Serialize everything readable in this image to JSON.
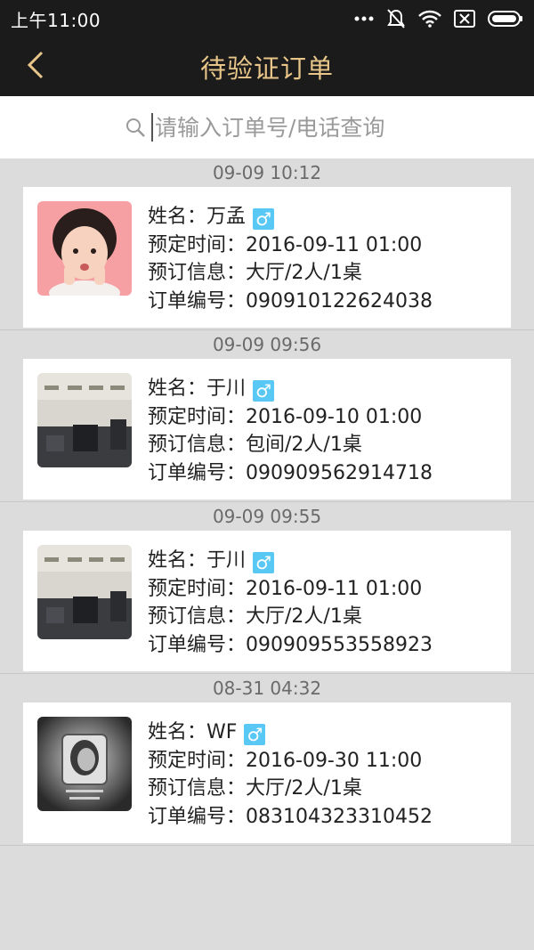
{
  "status_bar": {
    "time": "上午11:00",
    "icons": [
      "more-dots-icon",
      "mute-bell-icon",
      "wifi-icon",
      "sim-x-icon",
      "battery-icon"
    ]
  },
  "header": {
    "title": "待验证订单",
    "back_icon": "chevron-left-icon"
  },
  "search": {
    "placeholder": "请输入订单号/电话查询",
    "icon": "search-icon"
  },
  "colors": {
    "bar_bg": "#1b1b1b",
    "title": "#e8c68a",
    "page_bg": "#dcdcdc",
    "gender_badge": "#5ac8f5"
  },
  "labels": {
    "name": "姓名：",
    "time": "预定时间：",
    "info": "预订信息：",
    "order_no": "订单编号："
  },
  "orders": [
    {
      "date": "09-09 10:12",
      "name": "万孟",
      "gender": "♂",
      "reserve_time": "2016-09-11 01:00",
      "info": "大厅/2人/1桌",
      "order_no": "090910122624038"
    },
    {
      "date": "09-09 09:56",
      "name": "于川",
      "gender": "♂",
      "reserve_time": "2016-09-10 01:00",
      "info": "包间/2人/1桌",
      "order_no": "090909562914718"
    },
    {
      "date": "09-09 09:55",
      "name": "于川",
      "gender": "♂",
      "reserve_time": "2016-09-11 01:00",
      "info": "大厅/2人/1桌",
      "order_no": "090909553558923"
    },
    {
      "date": "08-31 04:32",
      "name": "WF",
      "gender": "♂",
      "reserve_time": "2016-09-30 11:00",
      "info": "大厅/2人/1桌",
      "order_no": "083104323310452"
    }
  ]
}
